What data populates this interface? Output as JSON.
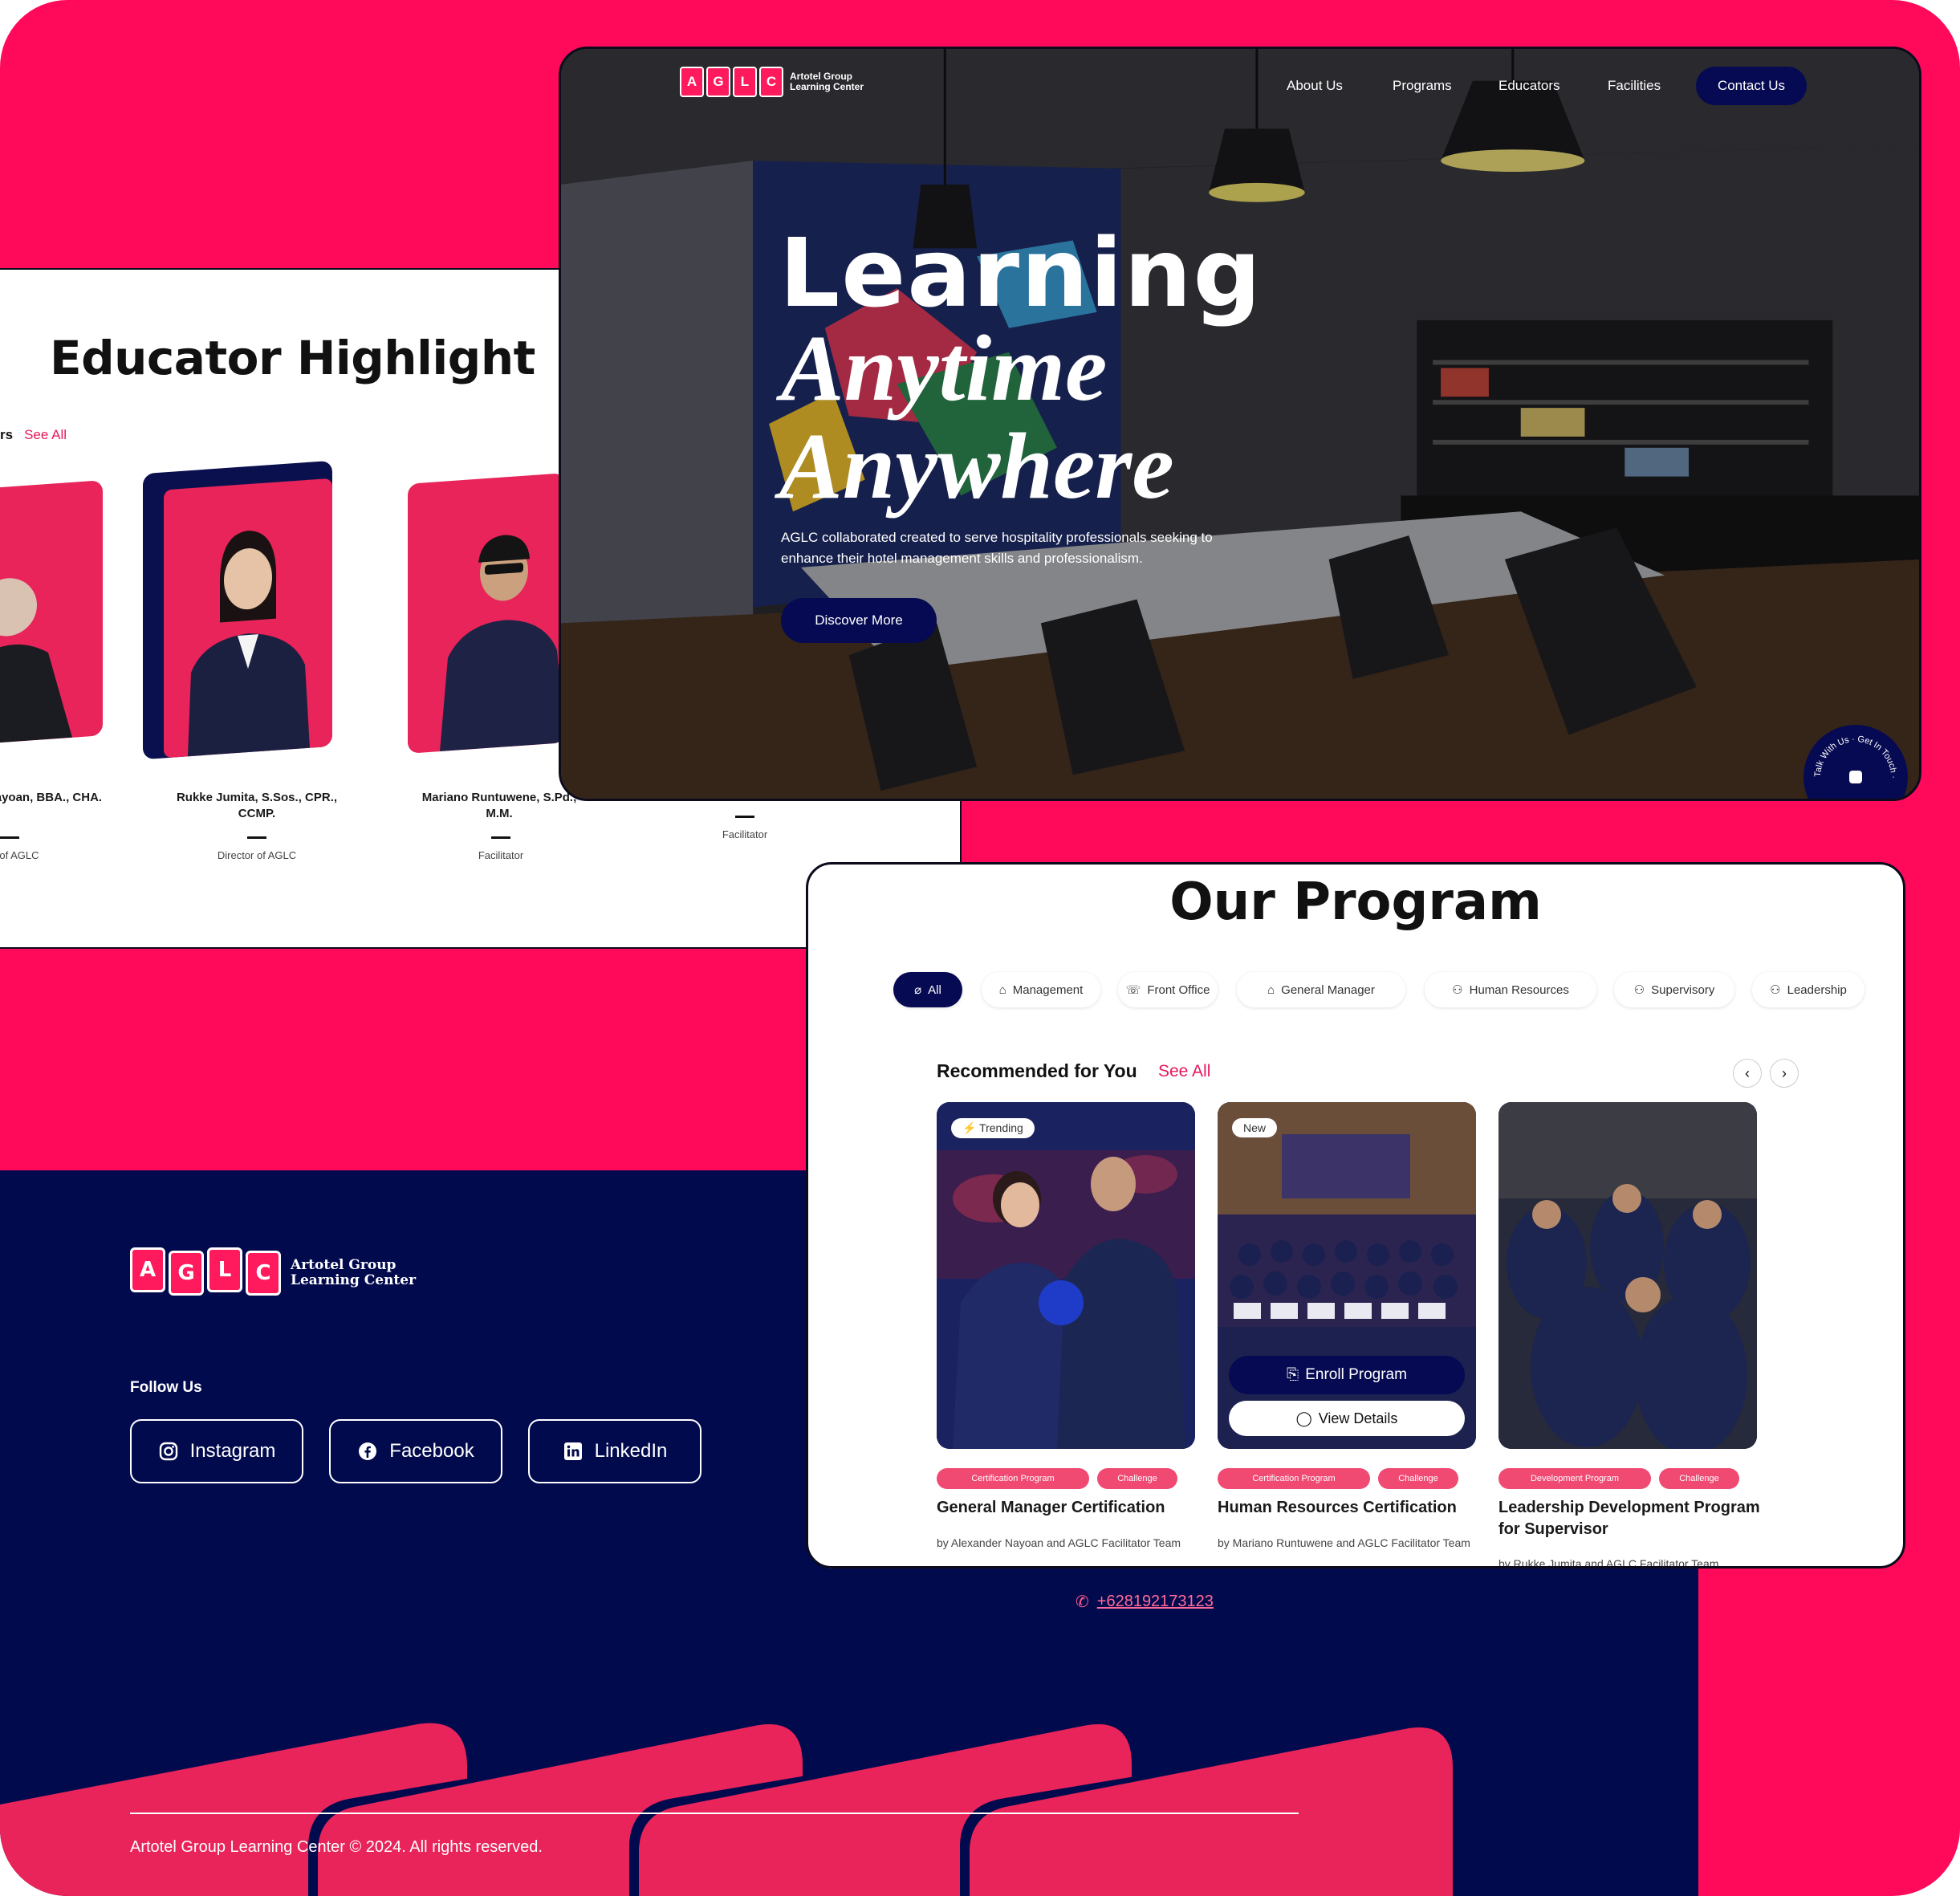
{
  "colors": {
    "brand_pink": "#ff0a5a",
    "navy": "#020a4e",
    "deep_navy": "#060a52"
  },
  "educator": {
    "heading": "Educator Highlight",
    "row_label": "rs",
    "see_all": "See All",
    "people": [
      {
        "name": "Nayoan, BBA., CHA.",
        "role": "r of AGLC"
      },
      {
        "name": "Rukke Jumita, S.Sos., CPR., CCMP.",
        "role": "Director of AGLC"
      },
      {
        "name": "Mariano Runtuwene, S.Pd., M.M.",
        "role": "Facilitator"
      },
      {
        "name": "",
        "role": "Facilitator"
      }
    ]
  },
  "hero": {
    "logo_text_1": "Artotel Group",
    "logo_text_2": "Learning Center",
    "nav": [
      "About Us",
      "Programs",
      "Educators",
      "Facilities"
    ],
    "contact": "Contact Us",
    "title_1": "Learning",
    "title_2": "Anytime",
    "title_3": "Anywhere",
    "description": "AGLC collaborated created to serve hospitality professionals seeking to enhance their hotel management skills and professionalism.",
    "cta": "Discover More",
    "badge_text": "Talk With Us · Get In Touch ·"
  },
  "program": {
    "heading": "Our Program",
    "tabs": [
      "All",
      "Management",
      "Front Office",
      "General Manager",
      "Human Resources",
      "Supervisory",
      "Leadership"
    ],
    "recommended": "Recommended for You",
    "see_all": "See All",
    "cards": [
      {
        "tag": "Trending",
        "title": "General Manager Certification",
        "by": "by Alexander Nayoan and AGLC Facilitator Team",
        "pill_1": "Certification Program",
        "pill_2": "Challenge"
      },
      {
        "tag": "New",
        "title": "Human Resources Certification",
        "by": "by Mariano Runtuwene and AGLC Facilitator Team",
        "pill_1": "Certification Program",
        "pill_2": "Challenge",
        "enroll": "Enroll Program",
        "details": "View Details"
      },
      {
        "tag": "",
        "title": "Leadership Development Program for Supervisor",
        "by": "by Rukke Jumita and AGLC Facilitator Team",
        "pill_1": "Development Program",
        "pill_2": "Challenge"
      }
    ]
  },
  "footer": {
    "brand_1": "Artotel Group",
    "brand_2": "Learning Center",
    "follow": "Follow Us",
    "socials": [
      "Instagram",
      "Facebook",
      "LinkedIn"
    ],
    "phone": "+628192173123",
    "copyright": "Artotel Group Learning Center © 2024. All rights reserved."
  }
}
